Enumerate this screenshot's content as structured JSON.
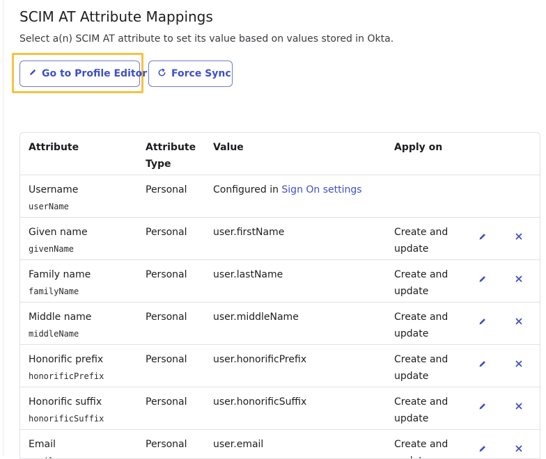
{
  "page": {
    "title": "SCIM AT Attribute Mappings",
    "subtitle": "Select a(n) SCIM AT attribute to set its value based on values stored in Okta."
  },
  "buttons": {
    "profile_editor": "Go to Profile Editor",
    "force_sync": "Force Sync"
  },
  "colors": {
    "accent": "#3f4fc7",
    "highlight": "#f5c242"
  },
  "table": {
    "headers": {
      "attribute": "Attribute",
      "type_line1": "Attribute",
      "type_line2": "Type",
      "value": "Value",
      "apply_on": "Apply on"
    },
    "rows": [
      {
        "name": "Username",
        "key": "userName",
        "type": "Personal",
        "value_prefix": "Configured in ",
        "value_link": "Sign On settings",
        "apply_l1": "",
        "apply_l2": "",
        "actions": false
      },
      {
        "name": "Given name",
        "key": "givenName",
        "type": "Personal",
        "value": "user.firstName",
        "apply_l1": "Create and",
        "apply_l2": "update",
        "actions": true
      },
      {
        "name": "Family name",
        "key": "familyName",
        "type": "Personal",
        "value": "user.lastName",
        "apply_l1": "Create and",
        "apply_l2": "update",
        "actions": true
      },
      {
        "name": "Middle name",
        "key": "middleName",
        "type": "Personal",
        "value": "user.middleName",
        "apply_l1": "Create and",
        "apply_l2": "update",
        "actions": true
      },
      {
        "name": "Honorific prefix",
        "key": "honorificPrefix",
        "type": "Personal",
        "value": "user.honorificPrefix",
        "apply_l1": "Create and",
        "apply_l2": "update",
        "actions": true
      },
      {
        "name": "Honorific suffix",
        "key": "honorificSuffix",
        "type": "Personal",
        "value": "user.honorificSuffix",
        "apply_l1": "Create and",
        "apply_l2": "update",
        "actions": true
      },
      {
        "name": "Email",
        "key": "email",
        "type": "Personal",
        "value": "user.email",
        "apply_l1": "Create and",
        "apply_l2": "update",
        "actions": true
      }
    ]
  }
}
